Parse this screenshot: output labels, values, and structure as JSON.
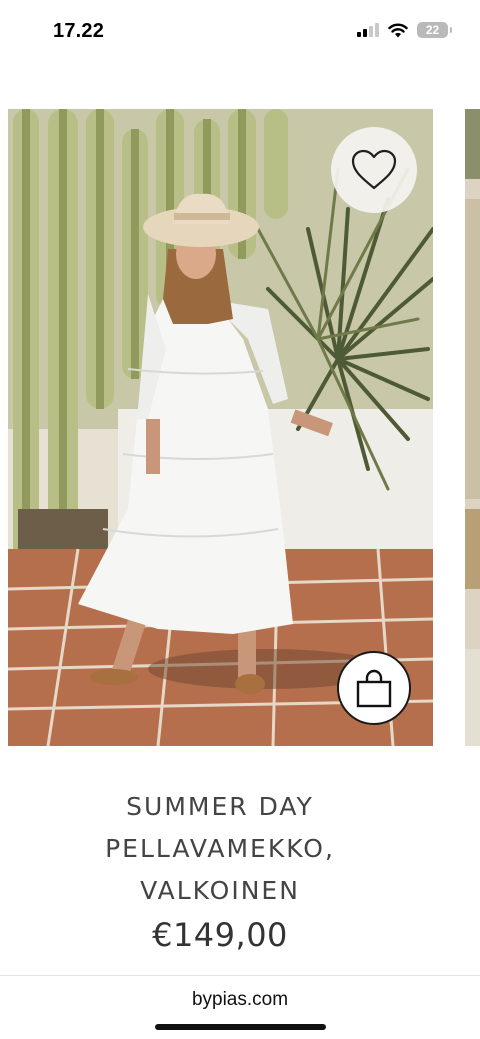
{
  "status_bar": {
    "time": "17.22",
    "battery_level": "22",
    "icons": [
      "cellular-signal-icon",
      "wifi-icon",
      "battery-icon"
    ]
  },
  "product": {
    "title_lines": [
      "SUMMER DAY",
      "PELLAVAMEKKO,",
      "VALKOINEN"
    ],
    "price": "€149,00",
    "image": "photo of woman in white linen dress and straw hat in front of cactus",
    "wishlist_icon": "heart-icon",
    "cart_icon": "shopping-bag-icon"
  },
  "browser": {
    "url": "bypias.com"
  },
  "colors": {
    "text": "#444444",
    "price": "#333333",
    "background": "#ffffff"
  }
}
